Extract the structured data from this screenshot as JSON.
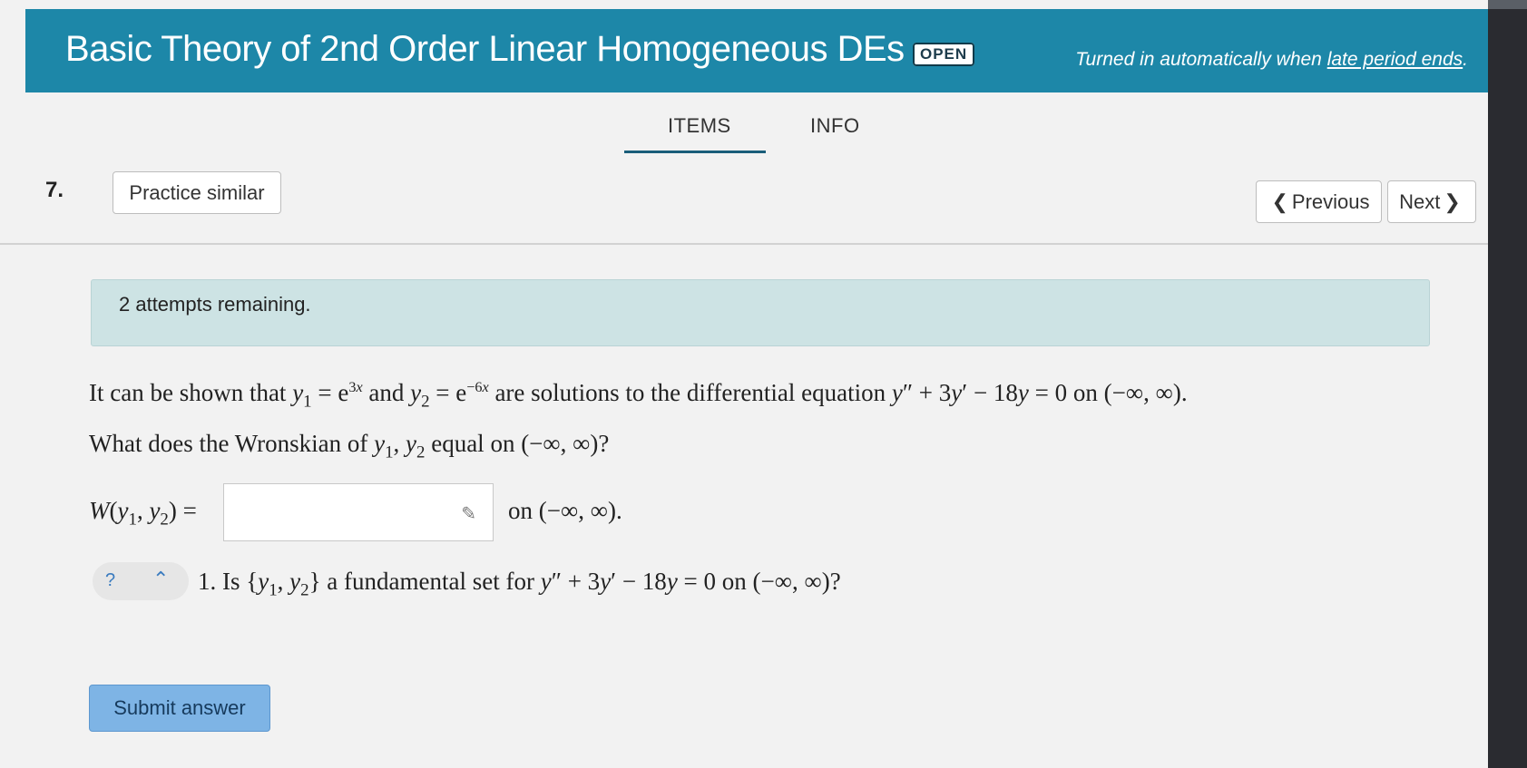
{
  "header": {
    "title": "Basic Theory of 2nd Order Linear Homogeneous DEs",
    "badge": "OPEN",
    "late_prefix": "Turned in automatically when ",
    "late_link": "late period ends",
    "late_suffix": "."
  },
  "tabs": [
    {
      "label": "ITEMS",
      "active": true
    },
    {
      "label": "INFO",
      "active": false
    }
  ],
  "question": {
    "number": "7.",
    "practice_label": "Practice similar",
    "prev_label": "Previous",
    "next_label": "Next"
  },
  "attempts": "2 attempts remaining.",
  "problem": {
    "line1_intro": "It can be shown that ",
    "line1_and": " and ",
    "line1_mid": " are solutions to the differential equation ",
    "line1_end": " on (−∞, ∞).",
    "line2_start": "What does the Wronskian of ",
    "line2_end": " equal on (−∞, ∞)?",
    "w_label": "W(y",
    "answer_value": "",
    "on_interval": "on (−∞, ∞).",
    "fund_question": "1. Is {y",
    "fund_end": "} a fundamental set for y″ + 3y′ − 18y = 0 on (−∞, ∞)?"
  },
  "dropdown": {
    "selected": "?"
  },
  "submit_label": "Submit answer",
  "colors": {
    "header": "#1d87a8",
    "submit": "#7eb4e5",
    "attempts_bg": "#cde3e4"
  }
}
